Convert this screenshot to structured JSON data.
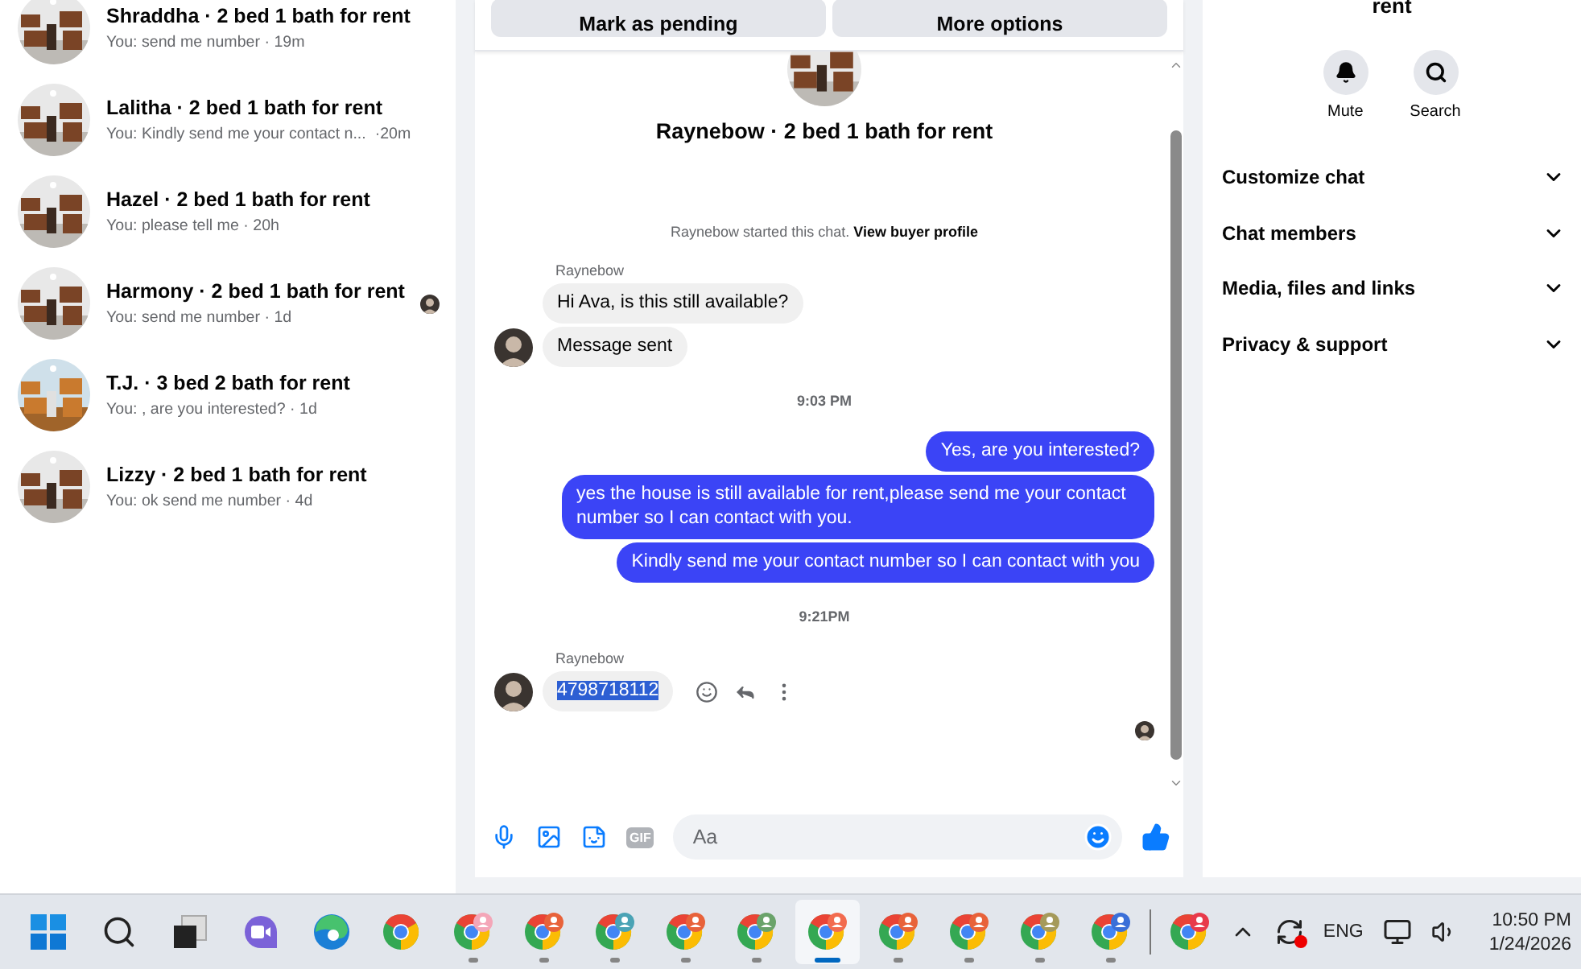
{
  "conversations": [
    {
      "title": "Shraddha · 2 bed 1 bath for rent",
      "preview": "You: send me number · 19m",
      "color": "#7a4426",
      "seen": false
    },
    {
      "title": "Lalitha · 2 bed 1 bath for rent",
      "preview": "You: Kindly send me your contact n...  ·20m",
      "color": "#7a4426",
      "seen": false
    },
    {
      "title": "Hazel · 2 bed 1 bath for rent",
      "preview": "You: please tell me · 20h",
      "color": "#7a4426",
      "seen": false
    },
    {
      "title": "Harmony · 2 bed 1 bath for rent",
      "preview": "You: send me number · 1d",
      "color": "#7a4426",
      "seen": true
    },
    {
      "title": "T.J. · 3 bed 2 bath for rent",
      "preview": "You: , are you interested? · 1d",
      "color": "#c97a2e",
      "seen": false
    },
    {
      "title": "Lizzy · 2 bed 1 bath for rent",
      "preview": "You: ok send me number · 4d",
      "color": "#7a4426",
      "seen": false
    }
  ],
  "chat": {
    "actions": [
      "Mark as pending",
      "More options"
    ],
    "title": "Raynebow · 2 bed 1 bath for rent",
    "messages": [
      {
        "kind": "notice",
        "text": "Raynebow started this chat.",
        "link": "View buyer profile"
      },
      {
        "kind": "sender",
        "text": "Raynebow"
      },
      {
        "kind": "incoming",
        "text": "Hi Ava, is this still available?",
        "avatar": false,
        "highlighted": false,
        "tools": false
      },
      {
        "kind": "incoming",
        "text": "Message sent",
        "avatar": true,
        "highlighted": false,
        "tools": false
      },
      {
        "kind": "time",
        "text": "9:03 PM"
      },
      {
        "kind": "outgoing",
        "text": "Yes, are you interested?"
      },
      {
        "kind": "outgoing",
        "text": "yes the house is still available for rent,please send me your contact number so I can contact with you."
      },
      {
        "kind": "outgoing",
        "text": "Kindly send me your contact number so I can contact with you"
      },
      {
        "kind": "time",
        "text": "9:21PM"
      },
      {
        "kind": "sender",
        "text": "Raynebow"
      },
      {
        "kind": "incoming",
        "text": "4798718112",
        "avatar": true,
        "highlighted": true,
        "tools": true
      }
    ],
    "read_receipt": true,
    "composer": {
      "gif_label": "GIF",
      "placeholder": "Aa"
    }
  },
  "details": {
    "title_end": "rent",
    "actions": [
      {
        "kind": "bell",
        "label": "Mute"
      },
      {
        "kind": "search",
        "label": "Search"
      }
    ],
    "sections": [
      {
        "label": "Customize chat",
        "expanded": false
      },
      {
        "label": "Chat members",
        "expanded": false
      },
      {
        "label": "Media, files and links",
        "expanded": false
      },
      {
        "label": "Privacy & support",
        "expanded": false
      }
    ]
  },
  "taskbar": {
    "apps": [
      {
        "kind": "start"
      },
      {
        "kind": "search"
      },
      {
        "kind": "taskview"
      },
      {
        "kind": "meet"
      },
      {
        "kind": "edge"
      },
      {
        "kind": "chrome",
        "running": false,
        "selected": false
      },
      {
        "kind": "chrome",
        "color": "#f4a6b8",
        "running": true,
        "selected": false
      },
      {
        "kind": "chrome",
        "color": "#e8623a",
        "running": true,
        "selected": false
      },
      {
        "kind": "chrome",
        "color": "#4aa3b5",
        "running": true,
        "selected": false
      },
      {
        "kind": "chrome",
        "color": "#e8623a",
        "running": true,
        "selected": false
      },
      {
        "kind": "chrome",
        "color": "#6aa36a",
        "running": true,
        "selected": false
      },
      {
        "kind": "chrome",
        "color": "#f26b4f",
        "running": true,
        "selected": true
      },
      {
        "kind": "chrome",
        "color": "#e8623a",
        "running": true,
        "selected": false
      },
      {
        "kind": "chrome",
        "color": "#e8623a",
        "running": true,
        "selected": false
      },
      {
        "kind": "chrome",
        "color": "#a59a5a",
        "running": true,
        "selected": false
      },
      {
        "kind": "chrome",
        "color": "#3a6fd8",
        "running": true,
        "selected": false
      },
      {
        "kind": "divider"
      },
      {
        "kind": "chrome",
        "color": "#e83a4a",
        "running": false,
        "selected": false
      }
    ],
    "language": "ENG",
    "time": "10:50 PM",
    "date": "1/24/2026"
  }
}
